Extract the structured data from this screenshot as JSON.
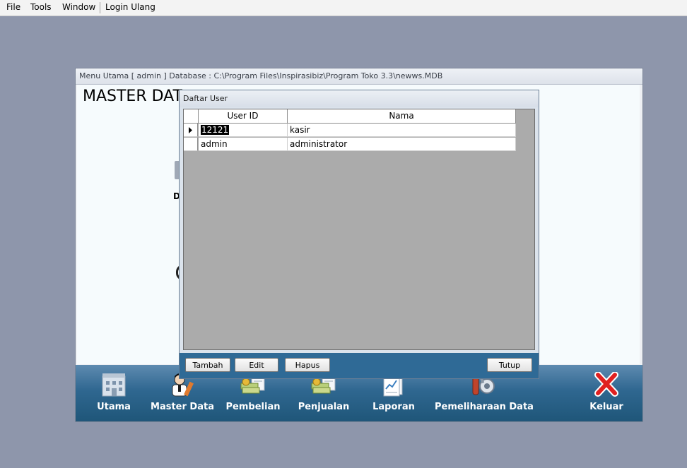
{
  "menubar": {
    "file": "File",
    "tools": "Tools",
    "window": "Window",
    "login": "Login Ulang"
  },
  "main_window": {
    "title": "Menu Utama [ admin ] Database : C:\\Program Files\\Inspirasibiz\\Program Toko 3.3\\newws.MDB",
    "content_title": "MASTER DAT",
    "partial_letter": "D"
  },
  "bottom_nav": {
    "items": [
      {
        "label": "Utama",
        "icon": "building-icon"
      },
      {
        "label": "Master Data",
        "icon": "user-pen-icon"
      },
      {
        "label": "Pembelian",
        "icon": "money-docs-icon"
      },
      {
        "label": "Penjualan",
        "icon": "money-docs-icon"
      },
      {
        "label": "Laporan",
        "icon": "report-chart-icon"
      },
      {
        "label": "Pemeliharaan Data",
        "icon": "tools-icon"
      },
      {
        "label": "Keluar",
        "icon": "close-x-icon"
      }
    ]
  },
  "dialog": {
    "title": "Daftar User",
    "columns": [
      "User ID",
      "Nama"
    ],
    "rows": [
      {
        "user_id": "12121",
        "nama": "kasir"
      },
      {
        "user_id": "admin",
        "nama": "administrator"
      }
    ],
    "buttons": {
      "add": "Tambah",
      "edit": "Edit",
      "delete": "Hapus",
      "close": "Tutup"
    }
  },
  "colors": {
    "desktop": "#8e96ab",
    "nav_bar": "#2f6790",
    "dialog_footer": "#2f6a96",
    "exit_icon": "#e02020"
  }
}
